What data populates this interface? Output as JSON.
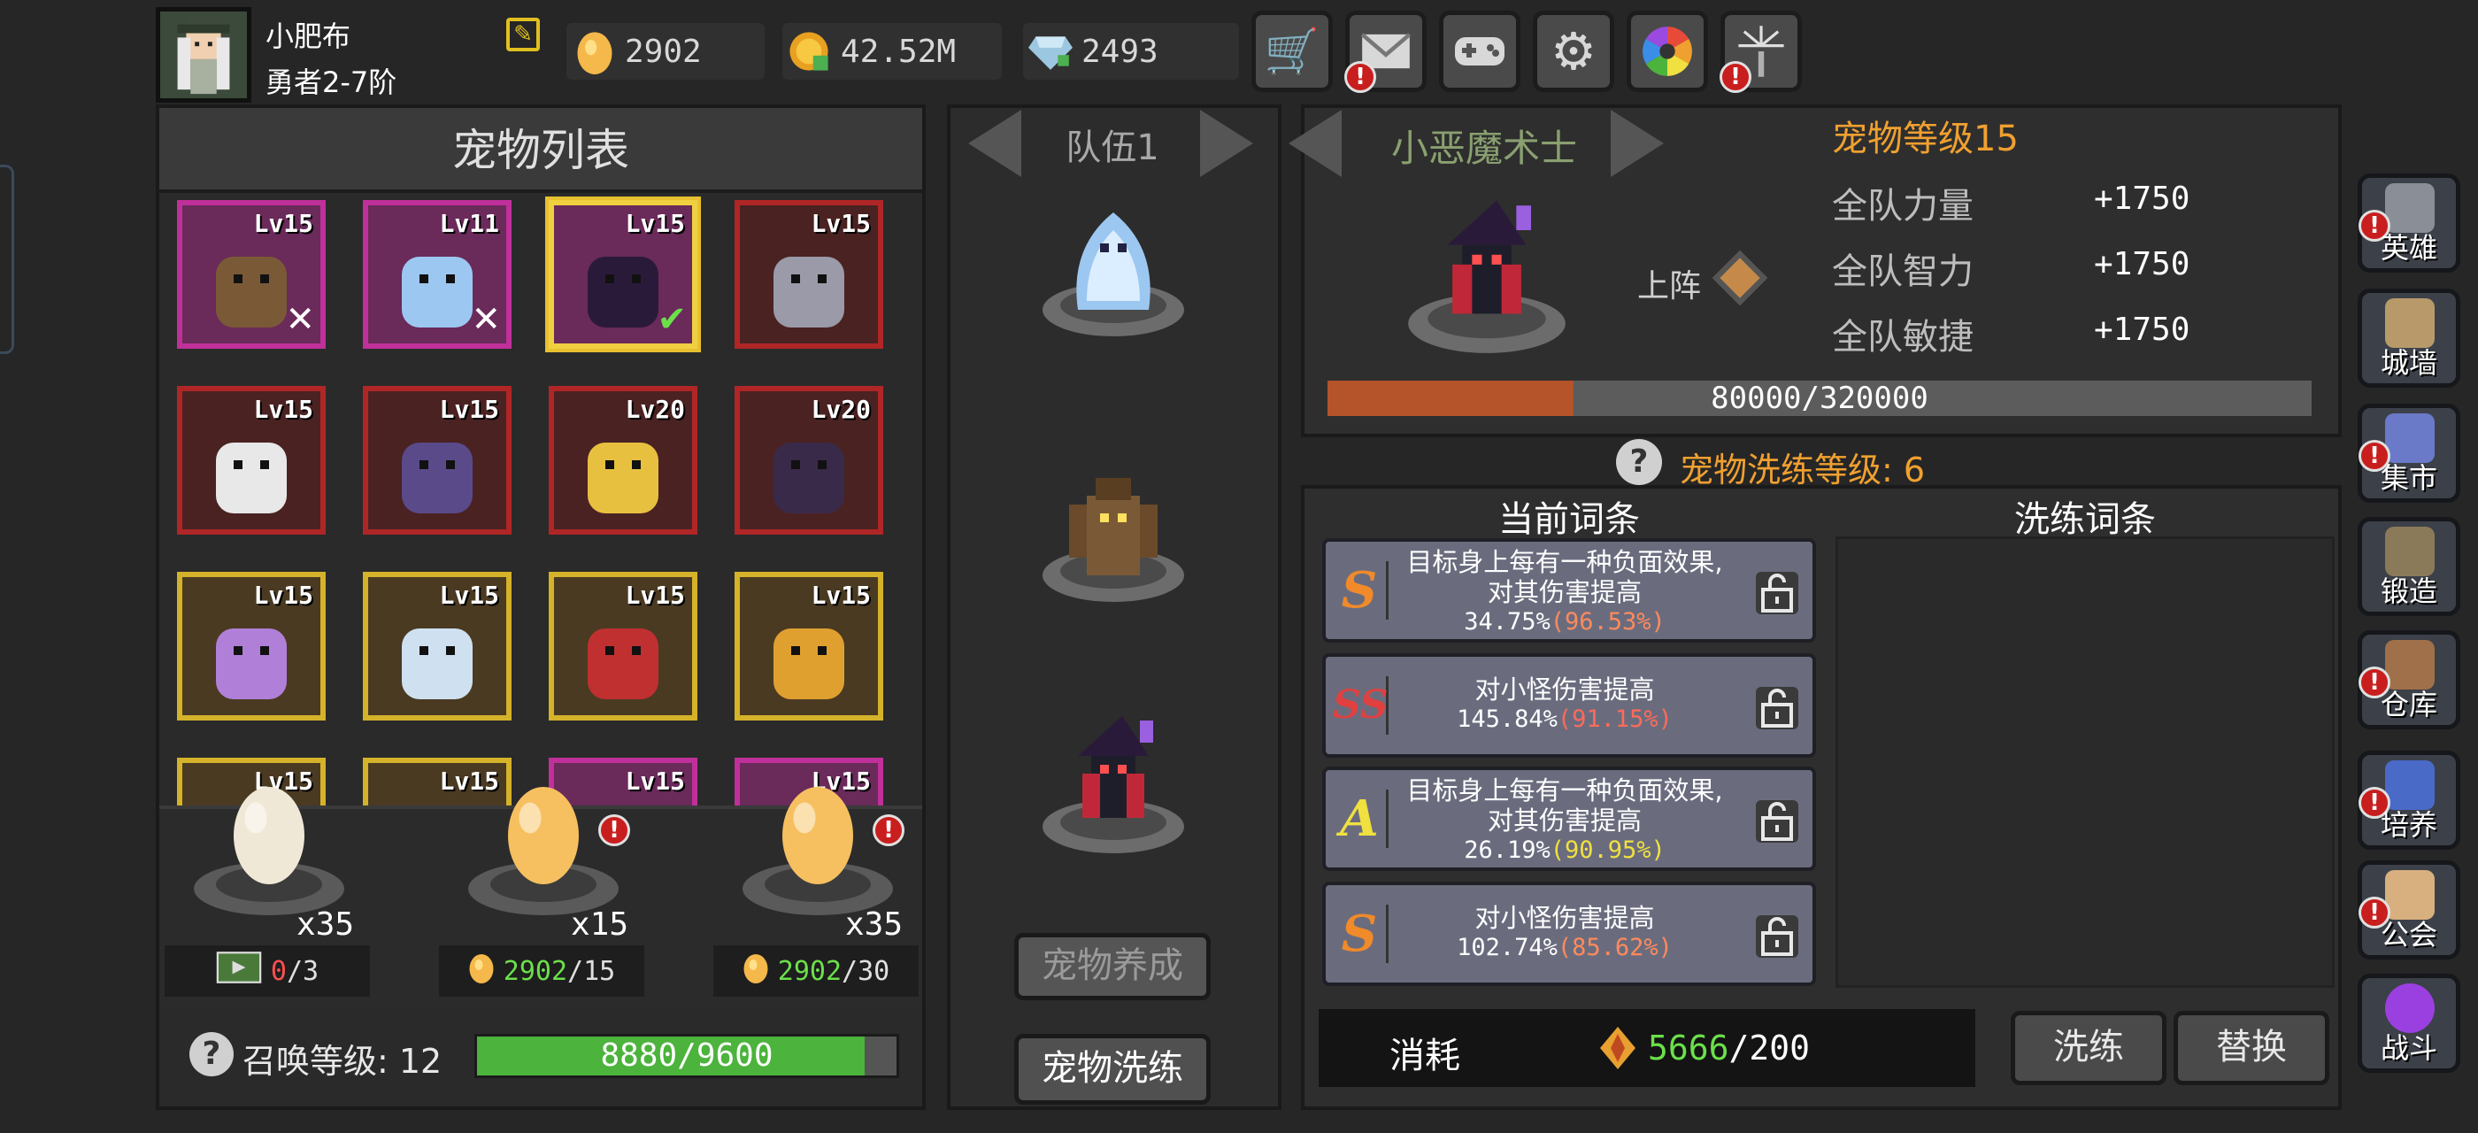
{
  "player": {
    "name": "小肥布",
    "rank": "勇者2-7阶"
  },
  "resources": [
    {
      "icon": "egg-coin-icon",
      "value": "2902"
    },
    {
      "icon": "gold-coin-icon",
      "value": "42.52M"
    },
    {
      "icon": "diamond-icon",
      "value": "2493"
    }
  ],
  "toolbar": [
    {
      "name": "shop-cart-button",
      "icon": "cart-icon",
      "badge": false
    },
    {
      "name": "mail-button",
      "icon": "mail-icon",
      "badge": true
    },
    {
      "name": "gamepad-button",
      "icon": "gamepad-icon",
      "badge": false
    },
    {
      "name": "settings-button",
      "icon": "gear-icon",
      "badge": false
    },
    {
      "name": "camera-button",
      "icon": "aperture-icon",
      "badge": false
    },
    {
      "name": "fireworks-button",
      "icon": "fireworks-icon",
      "badge": true
    }
  ],
  "pet_list": {
    "title": "宠物列表",
    "cards": [
      {
        "level": "Lv15",
        "rarity": "purple",
        "mark": "x"
      },
      {
        "level": "Lv11",
        "rarity": "purple",
        "mark": "x"
      },
      {
        "level": "Lv15",
        "rarity": "purple",
        "mark": "check",
        "selected": true
      },
      {
        "level": "Lv15",
        "rarity": "red",
        "mark": ""
      },
      {
        "level": "Lv15",
        "rarity": "red",
        "mark": ""
      },
      {
        "level": "Lv15",
        "rarity": "red",
        "mark": ""
      },
      {
        "level": "Lv20",
        "rarity": "red",
        "mark": ""
      },
      {
        "level": "Lv20",
        "rarity": "red",
        "mark": ""
      },
      {
        "level": "Lv15",
        "rarity": "gold",
        "mark": ""
      },
      {
        "level": "Lv15",
        "rarity": "gold",
        "mark": ""
      },
      {
        "level": "Lv15",
        "rarity": "gold",
        "mark": ""
      },
      {
        "level": "Lv15",
        "rarity": "gold",
        "mark": ""
      },
      {
        "level": "Lv15",
        "rarity": "gold",
        "mark": ""
      },
      {
        "level": "Lv15",
        "rarity": "gold",
        "mark": ""
      },
      {
        "level": "Lv15",
        "rarity": "purple",
        "mark": ""
      },
      {
        "level": "Lv15",
        "rarity": "purple",
        "mark": ""
      }
    ]
  },
  "eggs": [
    {
      "count": "x35",
      "cost_current": "0",
      "cost_total": "/3",
      "cost_icon": "video-ad-icon"
    },
    {
      "count": "x15",
      "cost_current": "2902",
      "cost_total": "/15",
      "cost_icon": "egg-coin-icon"
    },
    {
      "count": "x35",
      "cost_current": "2902",
      "cost_total": "/30",
      "cost_icon": "egg-coin-icon"
    }
  ],
  "summon": {
    "label": "召唤等级: 12",
    "progress_text": "8880/9600",
    "progress": 0.925
  },
  "team": {
    "label": "队伍1",
    "nurture_button": "宠物养成",
    "refine_button": "宠物洗练"
  },
  "pet_detail": {
    "name": "小恶魔术士",
    "level": "宠物等级15",
    "deploy": "上阵",
    "stats": [
      {
        "label": "全队力量",
        "value": "+1750"
      },
      {
        "label": "全队智力",
        "value": "+1750"
      },
      {
        "label": "全队敏捷",
        "value": "+1750"
      }
    ],
    "exp_text": "80000/320000",
    "exp_progress": 0.25
  },
  "refine": {
    "level_label": "宠物洗练等级: 6",
    "current_header": "当前词条",
    "refine_header": "洗练词条",
    "affixes": [
      {
        "grade": "S",
        "line1": "目标身上每有一种负面效果,",
        "line2": "对其伤害提高",
        "value": "34.75%",
        "max": "(96.53%)",
        "max_color": "#ff8a5c"
      },
      {
        "grade": "SS",
        "line1": "对小怪伤害提高",
        "line2": "",
        "value": "145.84%",
        "max": "(91.15%)",
        "max_color": "#ff6a5a"
      },
      {
        "grade": "A",
        "line1": "目标身上每有一种负面效果,",
        "line2": "对其伤害提高",
        "value": "26.19%",
        "max": "(90.95%)",
        "max_color": "#f0e040"
      },
      {
        "grade": "S",
        "line1": "对小怪伤害提高",
        "line2": "",
        "value": "102.74%",
        "max": "(85.62%)",
        "max_color": "#ff8a5c"
      }
    ],
    "cost_label": "消耗",
    "cost_current": "5666",
    "cost_total": "/200",
    "refine_button": "洗练",
    "replace_button": "替换"
  },
  "side_menu": [
    {
      "label": "英雄",
      "icon": "helmet-icon",
      "badge": true
    },
    {
      "label": "城墙",
      "icon": "castle-wall-icon",
      "badge": false
    },
    {
      "label": "集市",
      "icon": "market-icon",
      "badge": true
    },
    {
      "label": "锻造",
      "icon": "anvil-icon",
      "badge": false
    },
    {
      "label": "仓库",
      "icon": "warehouse-icon",
      "badge": true
    },
    {
      "label": "培养",
      "icon": "trophy-icon",
      "badge": true
    },
    {
      "label": "公会",
      "icon": "guild-icon",
      "badge": true
    },
    {
      "label": "战斗",
      "icon": "portal-icon",
      "badge": false
    }
  ],
  "colors": {
    "purple": "#c0309a",
    "red": "#b02626",
    "gold": "#d4b22a",
    "accent_orange": "#f0a030",
    "green_bar": "#4cb33c"
  }
}
